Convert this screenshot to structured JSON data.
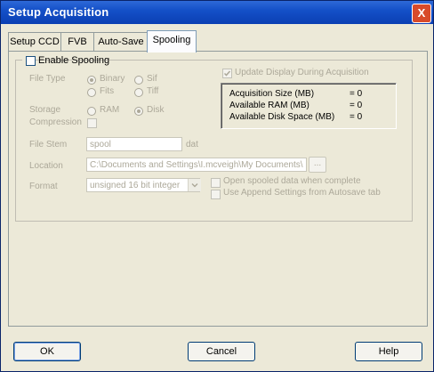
{
  "window": {
    "title": "Setup Acquisition",
    "close_glyph": "X"
  },
  "tabs": [
    {
      "label": "Setup CCD"
    },
    {
      "label": "FVB"
    },
    {
      "label": "Auto-Save"
    },
    {
      "label": "Spooling"
    }
  ],
  "spooling": {
    "enable_label": "Enable Spooling",
    "enable_checked": false,
    "update_display_label": "Update Display During Acquisition",
    "update_display_checked": true,
    "file_type_label": "File Type",
    "file_type_options": [
      "Binary",
      "Sif",
      "Fits",
      "Tiff"
    ],
    "file_type_selected": "Binary",
    "storage_label": "Storage",
    "storage_options": [
      "RAM",
      "Disk"
    ],
    "storage_selected": "Disk",
    "compression_label": "Compression",
    "compression_checked": false,
    "file_stem_label": "File Stem",
    "file_stem_value": "spool",
    "file_stem_ext": "dat",
    "location_label": "Location",
    "location_value": "C:\\Documents and Settings\\I.mcveigh\\My Documents\\",
    "browse_label": "...",
    "format_label": "Format",
    "format_value": "unsigned 16 bit integer",
    "open_spooled_label": "Open spooled data when complete",
    "open_spooled_checked": false,
    "use_append_label": "Use Append Settings from Autosave tab",
    "use_append_checked": false,
    "info": [
      {
        "label": "Acquisition Size (MB)",
        "value": "= 0"
      },
      {
        "label": "Available RAM (MB)",
        "value": "= 0"
      },
      {
        "label": "Available Disk Space (MB)",
        "value": "= 0"
      }
    ]
  },
  "buttons": {
    "ok": "OK",
    "cancel": "Cancel",
    "help": "Help"
  },
  "colors": {
    "titlebar": "#0b3fb3",
    "dialog_bg": "#ece9d8",
    "disabled_text": "#aca899"
  }
}
